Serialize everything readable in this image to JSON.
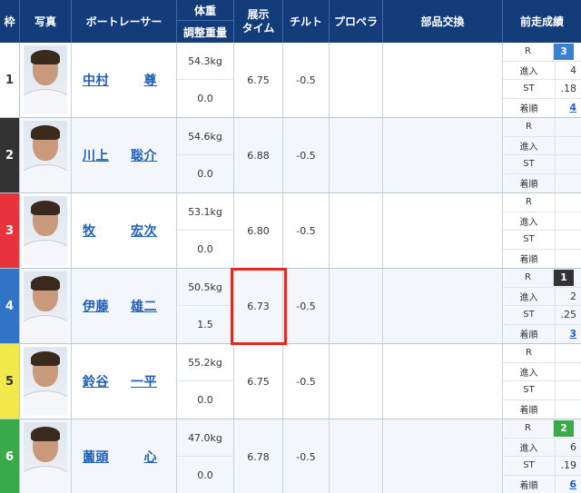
{
  "header": {
    "waku": "枠",
    "photo": "写真",
    "racer": "ボートレーサー",
    "weight_top": "体重",
    "weight_bottom": "調整重量",
    "exhibit_line1": "展示",
    "exhibit_line2": "タイム",
    "tilt": "チルト",
    "propeller": "プロペラ",
    "parts": "部品交換",
    "prev_results": "前走成績"
  },
  "result_labels": {
    "r": "R",
    "course": "進入",
    "st": "ST",
    "finish": "着順"
  },
  "rows": [
    {
      "waku": "1",
      "waku_color": "#ffffff",
      "waku_text": "#333333",
      "name_last": "中村",
      "name_first": "尊",
      "weight": "54.3kg",
      "adjust": "0.0",
      "exhibit": "6.75",
      "tilt": "-0.5",
      "propeller": "",
      "parts": "",
      "prev": {
        "r": "3",
        "r_color": "#3b7fd1",
        "course": "4",
        "st": ".18",
        "finish": "4"
      }
    },
    {
      "waku": "2",
      "waku_color": "#333333",
      "waku_text": "#ffffff",
      "name_last": "川上",
      "name_first": "聡介",
      "weight": "54.6kg",
      "adjust": "0.0",
      "exhibit": "6.88",
      "tilt": "-0.5",
      "propeller": "",
      "parts": "",
      "prev": {
        "r": "",
        "r_color": "",
        "course": "",
        "st": "",
        "finish": ""
      }
    },
    {
      "waku": "3",
      "waku_color": "#e8333c",
      "waku_text": "#ffffff",
      "name_last": "牧",
      "name_first": "宏次",
      "weight": "53.1kg",
      "adjust": "0.0",
      "exhibit": "6.80",
      "tilt": "-0.5",
      "propeller": "",
      "parts": "",
      "prev": {
        "r": "",
        "r_color": "",
        "course": "",
        "st": "",
        "finish": ""
      }
    },
    {
      "waku": "4",
      "waku_color": "#2f74c5",
      "waku_text": "#ffffff",
      "name_last": "伊藤",
      "name_first": "雄二",
      "weight": "50.5kg",
      "adjust": "1.5",
      "exhibit": "6.73",
      "tilt": "-0.5",
      "propeller": "",
      "parts": "",
      "prev": {
        "r": "1",
        "r_color": "#333333",
        "course": "2",
        "st": ".25",
        "finish": "3"
      }
    },
    {
      "waku": "5",
      "waku_color": "#f2e94a",
      "waku_text": "#333333",
      "name_last": "鈴谷",
      "name_first": "一平",
      "weight": "55.2kg",
      "adjust": "0.0",
      "exhibit": "6.75",
      "tilt": "-0.5",
      "propeller": "",
      "parts": "",
      "prev": {
        "r": "",
        "r_color": "",
        "course": "",
        "st": "",
        "finish": ""
      }
    },
    {
      "waku": "6",
      "waku_color": "#3aa94a",
      "waku_text": "#ffffff",
      "name_last": "薗頭",
      "name_first": "心",
      "weight": "47.0kg",
      "adjust": "0.0",
      "exhibit": "6.78",
      "tilt": "-0.5",
      "propeller": "",
      "parts": "",
      "prev": {
        "r": "2",
        "r_color": "#3aa94a",
        "course": "6",
        "st": ".19",
        "finish": "6"
      }
    }
  ],
  "highlight_color": "#e8261d"
}
